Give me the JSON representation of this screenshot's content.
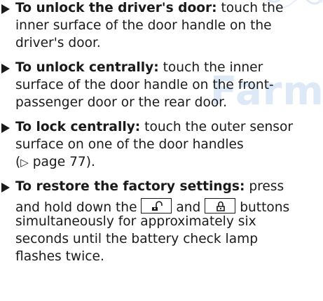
{
  "watermark": {
    "text": "FarmaS"
  },
  "items": [
    {
      "lead": "To unlock the driver's door:",
      "lines": [
        " touch the",
        "inner surface of the door handle on the",
        "driver's door."
      ]
    },
    {
      "lead": "To unlock centrally:",
      "lines": [
        " touch the inner",
        "surface of the door handle on the front-",
        "passenger door or the rear door."
      ]
    },
    {
      "lead": "To lock centrally:",
      "lines": [
        " touch the outer sensor",
        "surface on one of the door handles",
        "(",
        "page 77)."
      ],
      "ref_glyph": "▷"
    },
    {
      "lead": "To restore the factory settings:",
      "lines": [
        " press",
        "and hold down the",
        "and",
        "buttons",
        "simultaneously for approximately six",
        "seconds until the battery check lamp",
        "flashes twice."
      ]
    }
  ],
  "icons": {
    "unlock_button": "unlock-key-icon",
    "lock_button": "lock-key-icon",
    "bullet": "triangle-arrow-icon"
  }
}
